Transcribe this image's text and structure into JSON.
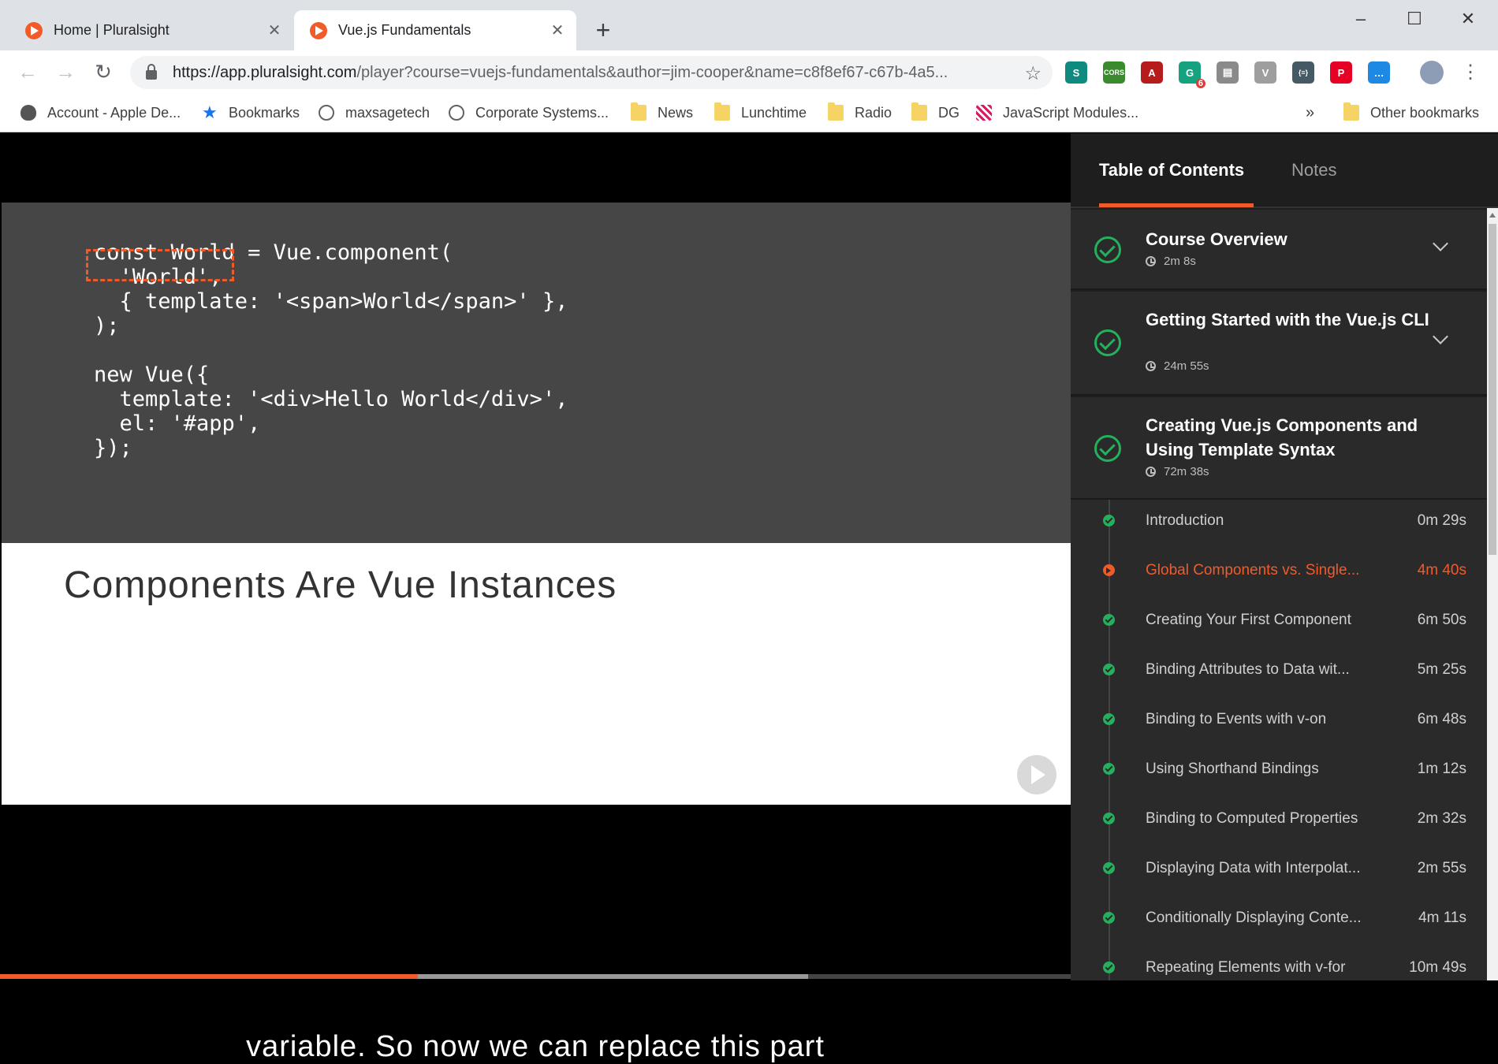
{
  "browser": {
    "tabs": [
      {
        "title": "Home | Pluralsight",
        "active": false
      },
      {
        "title": "Vue.js Fundamentals",
        "active": true
      }
    ],
    "new_tab_label": "+",
    "window_controls": {
      "minimize": "–",
      "maximize": "☐",
      "close": "✕"
    },
    "nav": {
      "back": "←",
      "forward": "→",
      "reload": "↻"
    },
    "url_host": "https://app.pluralsight.com",
    "url_rest": "/player?course=vuejs-fundamentals&author=jim-cooper&name=c8f8ef67-c67b-4a5...",
    "bookmark_star": "☆",
    "extensions": [
      {
        "name": "s-ext-icon",
        "label": "S",
        "color": "#0f8a7e"
      },
      {
        "name": "cors-ext-icon",
        "label": "CORS",
        "color": "#3a8a2e"
      },
      {
        "name": "pdf-ext-icon",
        "label": "A",
        "color": "#b71c1c"
      },
      {
        "name": "grammarly-ext-icon",
        "label": "G",
        "color": "#15a37f",
        "badge": "6"
      },
      {
        "name": "comment-ext-icon",
        "label": "▤",
        "color": "#8a8a8a"
      },
      {
        "name": "vue-devtools-ext-icon",
        "label": "V",
        "color": "#9e9e9e"
      },
      {
        "name": "json-ext-icon",
        "label": "{≡}",
        "color": "#455a64"
      },
      {
        "name": "pinterest-ext-icon",
        "label": "P",
        "color": "#e60023"
      },
      {
        "name": "messenger-ext-icon",
        "label": "…",
        "color": "#1e88e5"
      },
      {
        "name": "profile-avatar-icon",
        "label": "",
        "color": "#8d9db6"
      }
    ],
    "menu_label": "⋮",
    "bookmarks": [
      {
        "label": "Account - Apple De...",
        "icon": "apple"
      },
      {
        "label": "Bookmarks",
        "icon": "star"
      },
      {
        "label": "maxsagetech",
        "icon": "globe"
      },
      {
        "label": "Corporate Systems...",
        "icon": "globe"
      },
      {
        "label": "News",
        "icon": "folder"
      },
      {
        "label": "Lunchtime",
        "icon": "folder"
      },
      {
        "label": "Radio",
        "icon": "folder"
      },
      {
        "label": "DG",
        "icon": "folder"
      },
      {
        "label": "JavaScript Modules...",
        "icon": "jsm"
      }
    ],
    "bookmarks_overflow": "»",
    "other_bookmarks": "Other bookmarks"
  },
  "player": {
    "code_lines": [
      "const World = Vue.component(",
      "  'World',",
      "  { template: '<span>World</span>' },",
      ");",
      "",
      "new Vue({",
      "  template: '<div>Hello World</div>',",
      "  el: '#app',",
      "});"
    ],
    "slide_title": "Components Are Vue Instances",
    "caption": "variable. So now we can replace this part",
    "progress": {
      "played": 0.39,
      "buffered": 0.755
    }
  },
  "sidebar": {
    "tabs": {
      "toc": "Table of Contents",
      "notes": "Notes"
    },
    "modules": [
      {
        "title": "Course Overview",
        "duration": "2m 8s",
        "expanded": false
      },
      {
        "title": "Getting Started with the Vue.js CLI",
        "duration": "24m 55s",
        "expanded": false
      },
      {
        "title": "Creating Vue.js Components and Using Template Syntax",
        "duration": "72m 38s",
        "expanded": true
      }
    ],
    "clips": [
      {
        "title": "Introduction",
        "duration": "0m 29s",
        "current": false
      },
      {
        "title": "Global Components vs. Single...",
        "duration": "4m 40s",
        "current": true
      },
      {
        "title": "Creating Your First Component",
        "duration": "6m 50s",
        "current": false
      },
      {
        "title": "Binding Attributes to Data wit...",
        "duration": "5m 25s",
        "current": false
      },
      {
        "title": "Binding to Events with v-on",
        "duration": "6m 48s",
        "current": false
      },
      {
        "title": "Using Shorthand Bindings",
        "duration": "1m 12s",
        "current": false
      },
      {
        "title": "Binding to Computed Properties",
        "duration": "2m 32s",
        "current": false
      },
      {
        "title": "Displaying Data with Interpolat...",
        "duration": "2m 55s",
        "current": false
      },
      {
        "title": "Conditionally Displaying Conte...",
        "duration": "4m 11s",
        "current": false
      },
      {
        "title": "Repeating Elements with v-for",
        "duration": "10m 49s",
        "current": false
      }
    ],
    "accent_color": "#f15b2a",
    "complete_color": "#23b15e"
  }
}
